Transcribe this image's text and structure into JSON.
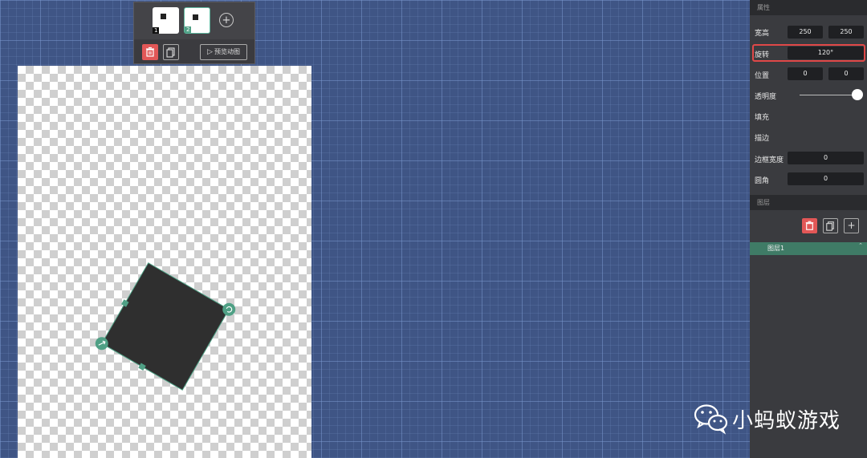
{
  "frames": {
    "items": [
      {
        "number": "1"
      },
      {
        "number": "2"
      }
    ],
    "add_label": "+",
    "delete_icon": "trash-icon",
    "copy_icon": "copy-icon",
    "preview_label": "预览动图"
  },
  "properties": {
    "header": "属性",
    "size_label": "宽高",
    "width": "250",
    "height": "250",
    "rotate_label": "旋转",
    "rotate_value": "120°",
    "position_label": "位置",
    "pos_x": "0",
    "pos_y": "0",
    "opacity_label": "透明度",
    "opacity_level": 1.0,
    "fill_label": "填充",
    "stroke_label": "描边",
    "border_width_label": "边框宽度",
    "border_width": "0",
    "radius_label": "圆角",
    "radius": "0"
  },
  "layers": {
    "header": "图层",
    "items": [
      {
        "label": "图层1"
      }
    ]
  },
  "shape": {
    "rotation_deg": 120,
    "fill": "#2f2f2f",
    "handle_color": "#4fa085"
  },
  "watermark": {
    "text": "小蚂蚁游戏"
  },
  "colors": {
    "accent": "#4fa085",
    "danger": "#e25757",
    "background": "#3f5585",
    "panel": "#3a3b3f"
  }
}
